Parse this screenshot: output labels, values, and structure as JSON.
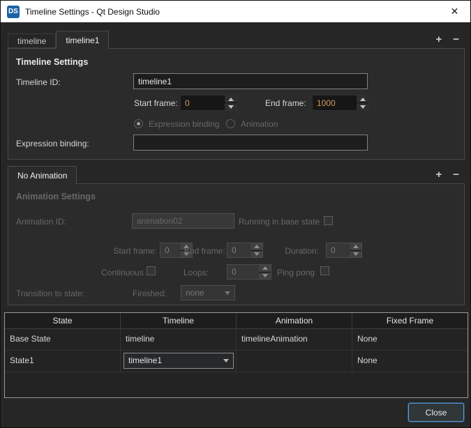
{
  "window": {
    "logo_text": "DS",
    "title": "Timeline Settings - Qt Design Studio",
    "close_icon": "✕"
  },
  "timeline_tabs": {
    "tabs": [
      {
        "label": "timeline",
        "active": false
      },
      {
        "label": "timeline1",
        "active": true
      }
    ],
    "add_icon": "+",
    "remove_icon": "−"
  },
  "timeline_settings": {
    "heading": "Timeline Settings",
    "timeline_id_label": "Timeline ID:",
    "timeline_id_value": "timeline1",
    "start_frame_label": "Start frame:",
    "start_frame_value": "0",
    "end_frame_label": "End frame:",
    "end_frame_value": "1000",
    "binding_options": [
      {
        "label": "Expression binding",
        "selected": true
      },
      {
        "label": "Animation",
        "selected": false
      }
    ],
    "expression_binding_label": "Expression binding:",
    "expression_binding_value": ""
  },
  "animation_tabs": {
    "tabs": [
      {
        "label": "No Animation",
        "active": true
      }
    ],
    "add_icon": "+",
    "remove_icon": "−"
  },
  "animation_settings": {
    "heading": "Animation Settings",
    "animation_id_label": "Animation ID:",
    "animation_id_value": "animation02",
    "running_in_base_state_label": "Running in base state",
    "running_in_base_state_checked": false,
    "start_frame_label": "Start frame:",
    "start_frame_value": "0",
    "end_frame_label": "End frame:",
    "end_frame_value": "0",
    "duration_label": "Duration:",
    "duration_value": "0",
    "continuous_label": "Continuous",
    "continuous_checked": false,
    "loops_label": "Loops:",
    "loops_value": "0",
    "ping_pong_label": "Ping pong",
    "ping_pong_checked": false,
    "transition_to_state_label": "Transition to state:",
    "finished_label": "Finished:",
    "finished_value": "none"
  },
  "state_table": {
    "columns": [
      "State",
      "Timeline",
      "Animation",
      "Fixed Frame"
    ],
    "rows": [
      {
        "state": "Base State",
        "timeline": "timeline",
        "animation": "timelineAnimation",
        "fixed_frame": "None",
        "timeline_editor": "text"
      },
      {
        "state": "State1",
        "timeline": "timeline1",
        "animation": "",
        "fixed_frame": "None",
        "timeline_editor": "dropdown"
      }
    ]
  },
  "footer": {
    "close_label": "Close"
  },
  "colors": {
    "accent_blue": "#5b9bd5",
    "numeric_value": "#d29a5e",
    "logo_bg": "#1c63a5",
    "titlebar_bg": "#ffffff"
  }
}
